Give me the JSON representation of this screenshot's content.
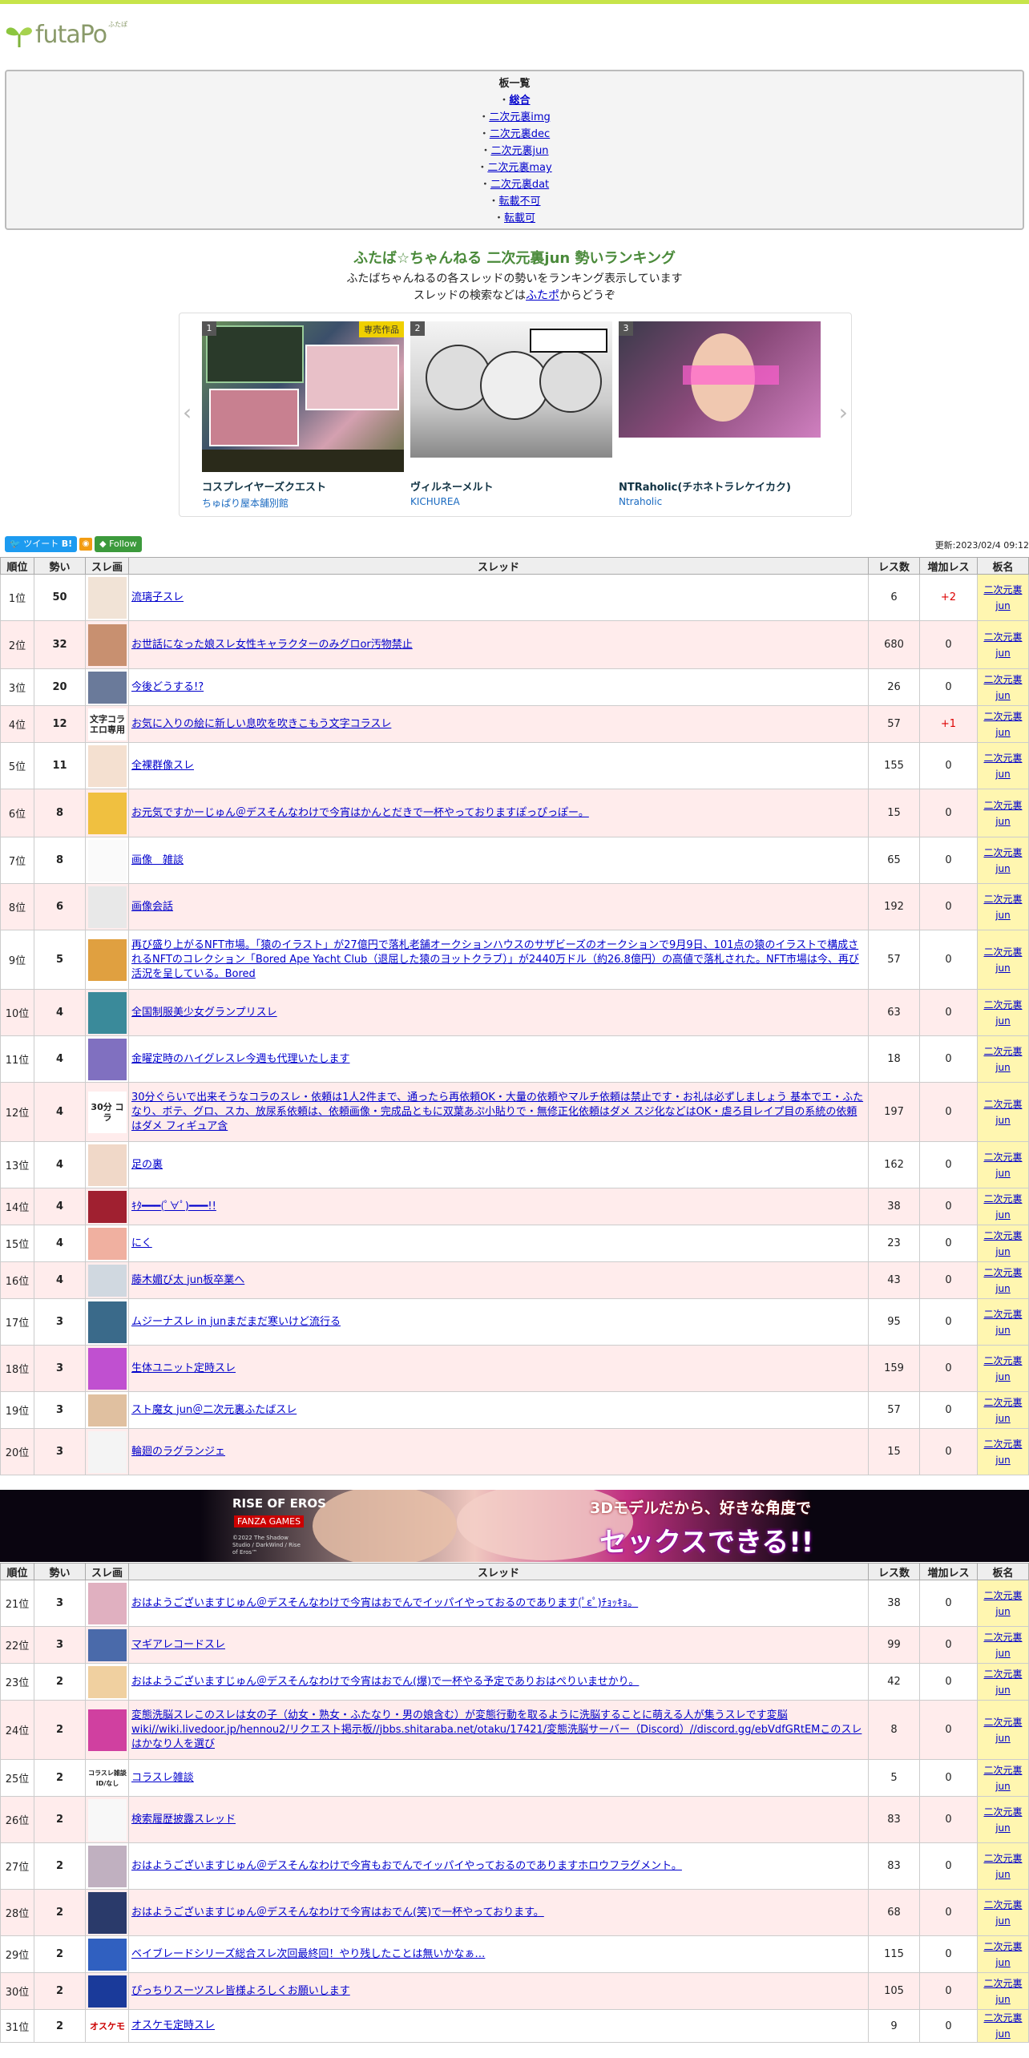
{
  "logo": {
    "text": "futaPo",
    "small": "ふたぽ"
  },
  "boards": {
    "title": "板一覧",
    "items": [
      "総合",
      "二次元裏img",
      "二次元裏dec",
      "二次元裏jun",
      "二次元裏may",
      "二次元裏dat",
      "転載不可",
      "転載可"
    ]
  },
  "intro": {
    "title": "ふたば☆ちゃんねる 二次元裏jun 勢いランキング",
    "line1": "ふたばちゃんねるの各スレッドの勢いをランキング表示しています",
    "line2_pre": "スレッドの検索などは",
    "line2_link": "ふたポ",
    "line2_post": "からどうぞ"
  },
  "carousel": {
    "items": [
      {
        "rank": "1",
        "badge": "専売作品",
        "title": "コスプレイヤーズクエスト",
        "sub": "ちゅぱり屋本舗別館"
      },
      {
        "rank": "2",
        "badge": "",
        "title": "ヴィルネーメルト",
        "sub": "KICHUREA"
      },
      {
        "rank": "3",
        "badge": "",
        "title": "NTRaholic(チホネトラレケイカク)",
        "sub": "Ntraholic"
      }
    ]
  },
  "social": {
    "tweet": "ツイート",
    "hatena": "B!",
    "follow": "Follow"
  },
  "updated": "更新:2023/02/4 09:12",
  "table_headers": [
    "順位",
    "勢い",
    "スレ画",
    "スレッド",
    "レス数",
    "増加レス",
    "板名"
  ],
  "rows1": [
    {
      "rank": "1位",
      "hot": "50",
      "title": "流璃子スレ",
      "res": "6",
      "inc": "+2",
      "board": "二次元裏jun"
    },
    {
      "rank": "2位",
      "hot": "32",
      "title": "お世話になった娘スレ女性キャラクターのみグロor汚物禁止",
      "res": "680",
      "inc": "0",
      "board": "二次元裏jun"
    },
    {
      "rank": "3位",
      "hot": "20",
      "title": "今後どうする!?",
      "res": "26",
      "inc": "0",
      "board": "二次元裏jun"
    },
    {
      "rank": "4位",
      "hot": "12",
      "title": "お気に入りの絵に新しい息吹を吹きこもう文字コラスレ",
      "res": "57",
      "inc": "+1",
      "board": "二次元裏jun"
    },
    {
      "rank": "5位",
      "hot": "11",
      "title": "全裸群像スレ",
      "res": "155",
      "inc": "0",
      "board": "二次元裏jun"
    },
    {
      "rank": "6位",
      "hot": "8",
      "title": "お元気ですかーじゅん＠デスそんなわけで今宵はかんとだきで一杯やっておりますぽっぴっぽー。",
      "res": "15",
      "inc": "0",
      "board": "二次元裏jun"
    },
    {
      "rank": "7位",
      "hot": "8",
      "title": "画像　雑談",
      "res": "65",
      "inc": "0",
      "board": "二次元裏jun"
    },
    {
      "rank": "8位",
      "hot": "6",
      "title": "画像会話",
      "res": "192",
      "inc": "0",
      "board": "二次元裏jun"
    },
    {
      "rank": "9位",
      "hot": "5",
      "title": "再び盛り上がるNFT市場。「猿のイラスト」が27億円で落札老舗オークションハウスのサザビーズのオークションで9月9日、101点の猿のイラストで構成されるNFTのコレクション「Bored Ape Yacht Club（退屈した猿のヨットクラブ）」が2440万ドル（約26.8億円）の高値で落札された。NFT市場は今、再び活況を呈している。Bored",
      "res": "57",
      "inc": "0",
      "board": "二次元裏jun"
    },
    {
      "rank": "10位",
      "hot": "4",
      "title": "全国制服美少女グランプリスレ",
      "res": "63",
      "inc": "0",
      "board": "二次元裏jun"
    },
    {
      "rank": "11位",
      "hot": "4",
      "title": "金曜定時のハイグレスレ今週も代理いたします",
      "res": "18",
      "inc": "0",
      "board": "二次元裏jun"
    },
    {
      "rank": "12位",
      "hot": "4",
      "title": "30分ぐらいで出来そうなコラのスレ・依頼は1人2件まで、通ったら再依頼OK・大量の依頼やマルチ依頼は禁止です・お礼は必ずしましょう 基本でエ・ふたなり、ボテ、グロ、スカ、放尿系依頼は、依頼画像・完成品ともに双葉あぷ小貼りで・無修正化依頼はダメ スジ化などはOK・虐ろ目レイプ目の系統の依頼はダメ フィギュア含",
      "res": "197",
      "inc": "0",
      "board": "二次元裏jun"
    },
    {
      "rank": "13位",
      "hot": "4",
      "title": "足の裏",
      "res": "162",
      "inc": "0",
      "board": "二次元裏jun"
    },
    {
      "rank": "14位",
      "hot": "4",
      "title": "ｷﾀ━━━(ﾟ∀ﾟ)━━━!!",
      "res": "38",
      "inc": "0",
      "board": "二次元裏jun"
    },
    {
      "rank": "15位",
      "hot": "4",
      "title": "にく",
      "res": "23",
      "inc": "0",
      "board": "二次元裏jun"
    },
    {
      "rank": "16位",
      "hot": "4",
      "title": "藤木媚び太 jun板卒業へ",
      "res": "43",
      "inc": "0",
      "board": "二次元裏jun"
    },
    {
      "rank": "17位",
      "hot": "3",
      "title": "ムジーナスレ in junまだまだ寒いけど流行る",
      "res": "95",
      "inc": "0",
      "board": "二次元裏jun"
    },
    {
      "rank": "18位",
      "hot": "3",
      "title": "生体ユニット定時スレ",
      "res": "159",
      "inc": "0",
      "board": "二次元裏jun"
    },
    {
      "rank": "19位",
      "hot": "3",
      "title": "スト魔女 jun＠二次元裏ふたばスレ",
      "res": "57",
      "inc": "0",
      "board": "二次元裏jun"
    },
    {
      "rank": "20位",
      "hot": "3",
      "title": "輪廻のラグランジェ",
      "res": "15",
      "inc": "0",
      "board": "二次元裏jun"
    }
  ],
  "banner": {
    "brand": "RISE OF EROS",
    "sub": "FANZA GAMES",
    "copy": "©2022 The Shadow Studio / DarkWind / Rise of Eros™",
    "tag": "3Dモデルだから、好きな角度で",
    "headline": "セックスできる!!"
  },
  "rows2": [
    {
      "rank": "21位",
      "hot": "3",
      "title": "おはようございますじゅん＠デスそんなわけで今宵はおでんでイッパイやっておるのであります(ﾟεﾟ)ﾁｮｯｷｮ。",
      "res": "38",
      "inc": "0",
      "board": "二次元裏jun"
    },
    {
      "rank": "22位",
      "hot": "3",
      "title": "マギアレコードスレ",
      "res": "99",
      "inc": "0",
      "board": "二次元裏jun"
    },
    {
      "rank": "23位",
      "hot": "2",
      "title": "おはようございますじゅん＠デスそんなわけで今宵はおでん(爆)で一杯やる予定でありおはぺりいませかり。",
      "res": "42",
      "inc": "0",
      "board": "二次元裏jun"
    },
    {
      "rank": "24位",
      "hot": "2",
      "title": "変態洗脳スレこのスレは女の子（幼女・熟女・ふたなり・男の娘含む）が変態行動を取るように洗脳することに萌える人が集うスレです変脳wiki//wiki.livedoor.jp/hennou2/リクエスト掲示板//jbbs.shitaraba.net/otaku/17421/変態洗脳サーバー（Discord）//discord.gg/ebVdfGRtEMこのスレはかなり人を選び",
      "res": "8",
      "inc": "0",
      "board": "二次元裏jun"
    },
    {
      "rank": "25位",
      "hot": "2",
      "title": "コラスレ雑談",
      "res": "5",
      "inc": "0",
      "board": "二次元裏jun",
      "thumbtext": "コラスレ雑談 ID/なし"
    },
    {
      "rank": "26位",
      "hot": "2",
      "title": "検索履歴披露スレッド",
      "res": "83",
      "inc": "0",
      "board": "二次元裏jun"
    },
    {
      "rank": "27位",
      "hot": "2",
      "title": "おはようございますじゅん＠デスそんなわけで今宵もおでんでイッパイやっておるのでありますホロウフラグメント。",
      "res": "83",
      "inc": "0",
      "board": "二次元裏jun"
    },
    {
      "rank": "28位",
      "hot": "2",
      "title": "おはようございますじゅん＠デスそんなわけで今宵はおでん(笑)で一杯やっております。",
      "res": "68",
      "inc": "0",
      "board": "二次元裏jun"
    },
    {
      "rank": "29位",
      "hot": "2",
      "title": "ベイブレードシリーズ総合スレ次回最終回！やり残したことは無いかなぁ…",
      "res": "115",
      "inc": "0",
      "board": "二次元裏jun"
    },
    {
      "rank": "30位",
      "hot": "2",
      "title": "ぴっちりスーツスレ皆様よろしくお願いします",
      "res": "105",
      "inc": "0",
      "board": "二次元裏jun"
    },
    {
      "rank": "31位",
      "hot": "2",
      "title": "オスケモ定時スレ",
      "res": "9",
      "inc": "0",
      "board": "二次元裏jun",
      "thumbtext": "オスケモ"
    }
  ],
  "thumb_labels": {
    "r4": "文字コラ エロ専用",
    "r12": "30分 コラ"
  },
  "colors": {
    "accent": "#c7e44a",
    "alt_row": "#ffecec",
    "board_cell": "#fff6b0",
    "link": "#0000cc"
  }
}
